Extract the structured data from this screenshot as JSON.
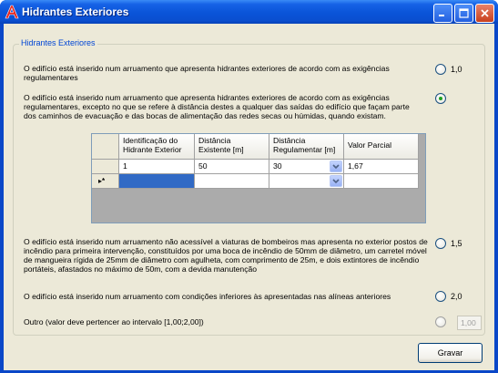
{
  "window": {
    "title": "Hidrantes Exteriores"
  },
  "group": {
    "title": "Hidrantes Exteriores"
  },
  "options": [
    {
      "text": "O edifício está inserido num arruamento que apresenta hidrantes exteriores de acordo com as exigências regulamentares",
      "value": "1,0",
      "checked": false
    },
    {
      "text": "O edifício está inserido num arruamento que apresenta hidrantes exteriores de acordo com as exigências regulamentares, excepto no que se refere à distância destes a qualquer das saídas do edifício que façam parte dos caminhos de evacuação e das bocas de alimentação das redes secas ou húmidas, quando existam.",
      "value": "",
      "checked": true
    },
    {
      "text": "O edifício está inserido num arruamento não acessível a viaturas de bombeiros mas apresenta no exterior postos de incêndio para primeira intervenção, constituídos por uma boca de incêndio de 50mm de diâmetro, um carretel móvel de mangueira rígida de 25mm de diâmetro com agulheta, com comprimento de 25m, e dois extintores de incêndio portáteis, afastados no máximo de 50m, com a devida manutenção",
      "value": "1,5",
      "checked": false
    },
    {
      "text": "O edifício está inserido num arruamento com condições inferiores às apresentadas nas alíneas anteriores",
      "value": "2,0",
      "checked": false
    },
    {
      "text": "Outro (valor deve pertencer ao intervalo [1,00;2,00])",
      "value": "1,00",
      "checked": false
    }
  ],
  "grid": {
    "columns": [
      "Identificação do Hidrante Exterior",
      "Distância Existente [m]",
      "Distância Regulamentar [m]",
      "Valor Parcial"
    ],
    "rows": [
      [
        "1",
        "50",
        "30",
        "1,67"
      ]
    ],
    "new_row_marker": "▸*"
  },
  "buttons": {
    "save": "Gravar"
  },
  "colors": {
    "titlebar": "#0a54d8",
    "group_title": "#0046d5",
    "selection": "#316ac5",
    "radio_checked": "#21a121"
  }
}
